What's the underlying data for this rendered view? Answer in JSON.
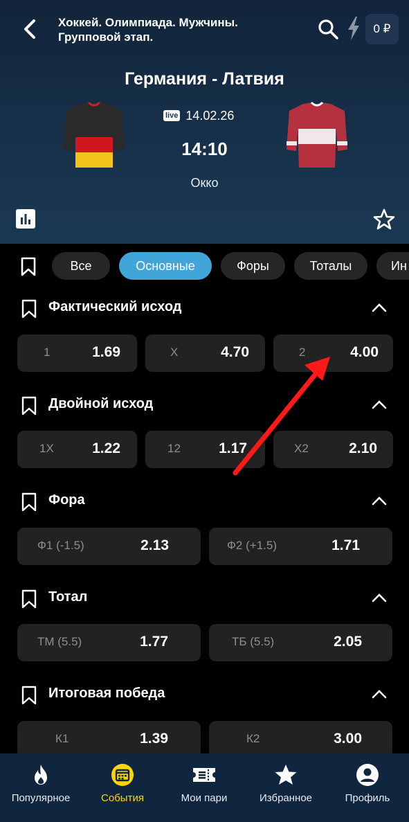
{
  "header": {
    "title": "Хоккей. Олимпиада. Мужчины. Групповой этап.",
    "balance": "0 ₽"
  },
  "match": {
    "teams": "Германия - Латвия",
    "live_badge": "live",
    "date": "14.02.26",
    "time": "14:10",
    "channel": "Окко"
  },
  "filters": [
    {
      "label": "Все",
      "active": false
    },
    {
      "label": "Основные",
      "active": true
    },
    {
      "label": "Форы",
      "active": false
    },
    {
      "label": "Тоталы",
      "active": false
    },
    {
      "label": "Ин",
      "active": false
    }
  ],
  "sections": [
    {
      "title": "Фактический исход",
      "odds": [
        {
          "label": "1",
          "value": "1.69"
        },
        {
          "label": "X",
          "value": "4.70"
        },
        {
          "label": "2",
          "value": "4.00"
        }
      ]
    },
    {
      "title": "Двойной исход",
      "odds": [
        {
          "label": "1X",
          "value": "1.22"
        },
        {
          "label": "12",
          "value": "1.17"
        },
        {
          "label": "X2",
          "value": "2.10"
        }
      ]
    },
    {
      "title": "Фора",
      "odds": [
        {
          "label": "Ф1 (-1.5)",
          "value": "2.13"
        },
        {
          "label": "Ф2 (+1.5)",
          "value": "1.71"
        }
      ]
    },
    {
      "title": "Тотал",
      "odds": [
        {
          "label": "ТМ (5.5)",
          "value": "1.77"
        },
        {
          "label": "ТБ (5.5)",
          "value": "2.05"
        }
      ]
    },
    {
      "title": "Итоговая победа",
      "odds": [
        {
          "label": "К1",
          "value": "1.39"
        },
        {
          "label": "К2",
          "value": "3.00"
        }
      ]
    }
  ],
  "nav": [
    {
      "label": "Популярное",
      "icon": "flame-icon",
      "active": false
    },
    {
      "label": "События",
      "icon": "calendar-icon",
      "active": true
    },
    {
      "label": "Мои пари",
      "icon": "ticket-icon",
      "active": false
    },
    {
      "label": "Избранное",
      "icon": "star-icon",
      "active": false
    },
    {
      "label": "Профиль",
      "icon": "profile-icon",
      "active": false
    }
  ],
  "colors": {
    "accent": "#42a5d9",
    "nav_active": "#ffd600",
    "annotation_arrow": "#ff1a1a"
  }
}
